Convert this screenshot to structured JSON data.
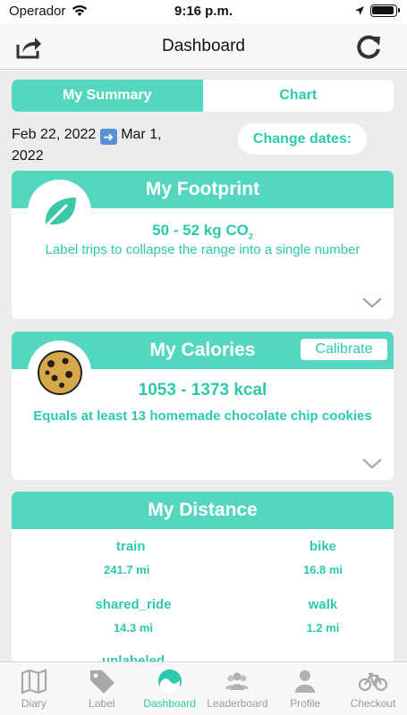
{
  "status_bar": {
    "carrier": "Operador",
    "time": "9:16 p.m."
  },
  "nav": {
    "title": "Dashboard"
  },
  "segments": [
    {
      "label": "My Summary",
      "active": true
    },
    {
      "label": "Chart",
      "active": false
    }
  ],
  "dates": {
    "start": "Feb 22, 2022",
    "end_line1": "Mar 1,",
    "end_line2": "2022",
    "change_label": "Change dates:"
  },
  "footprint": {
    "title": "My Footprint",
    "range": "50 - 52 kg CO",
    "range_subscript": "2",
    "hint": "Label trips to collapse the range into a single number",
    "icon": "leaf-icon"
  },
  "calories": {
    "title": "My Calories",
    "calibrate_label": "Calibrate",
    "range": "1053 - 1373 kcal",
    "equivalent": "Equals at least 13 homemade chocolate chip cookies",
    "icon": "cookie-icon"
  },
  "distance": {
    "title": "My Distance",
    "modes": [
      {
        "mode": "train",
        "value": "241.7 mi"
      },
      {
        "mode": "bike",
        "value": "16.8 mi"
      },
      {
        "mode": "shared_ride",
        "value": "14.3 mi"
      },
      {
        "mode": "walk",
        "value": "1.2 mi"
      },
      {
        "mode": "unlabeled",
        "value": ""
      }
    ]
  },
  "tabs": [
    {
      "label": "Diary",
      "icon": "map-icon"
    },
    {
      "label": "Label",
      "icon": "tag-icon"
    },
    {
      "label": "Dashboard",
      "icon": "dashboard-icon",
      "active": true
    },
    {
      "label": "Leaderboard",
      "icon": "people-icon"
    },
    {
      "label": "Profile",
      "icon": "person-icon"
    },
    {
      "label": "Checkout",
      "icon": "bicycle-icon"
    }
  ],
  "colors": {
    "accent": "#55d7bf",
    "accent_text": "#2cc9ac",
    "background": "#ececec",
    "inactive_tab": "#9a9a9a"
  }
}
